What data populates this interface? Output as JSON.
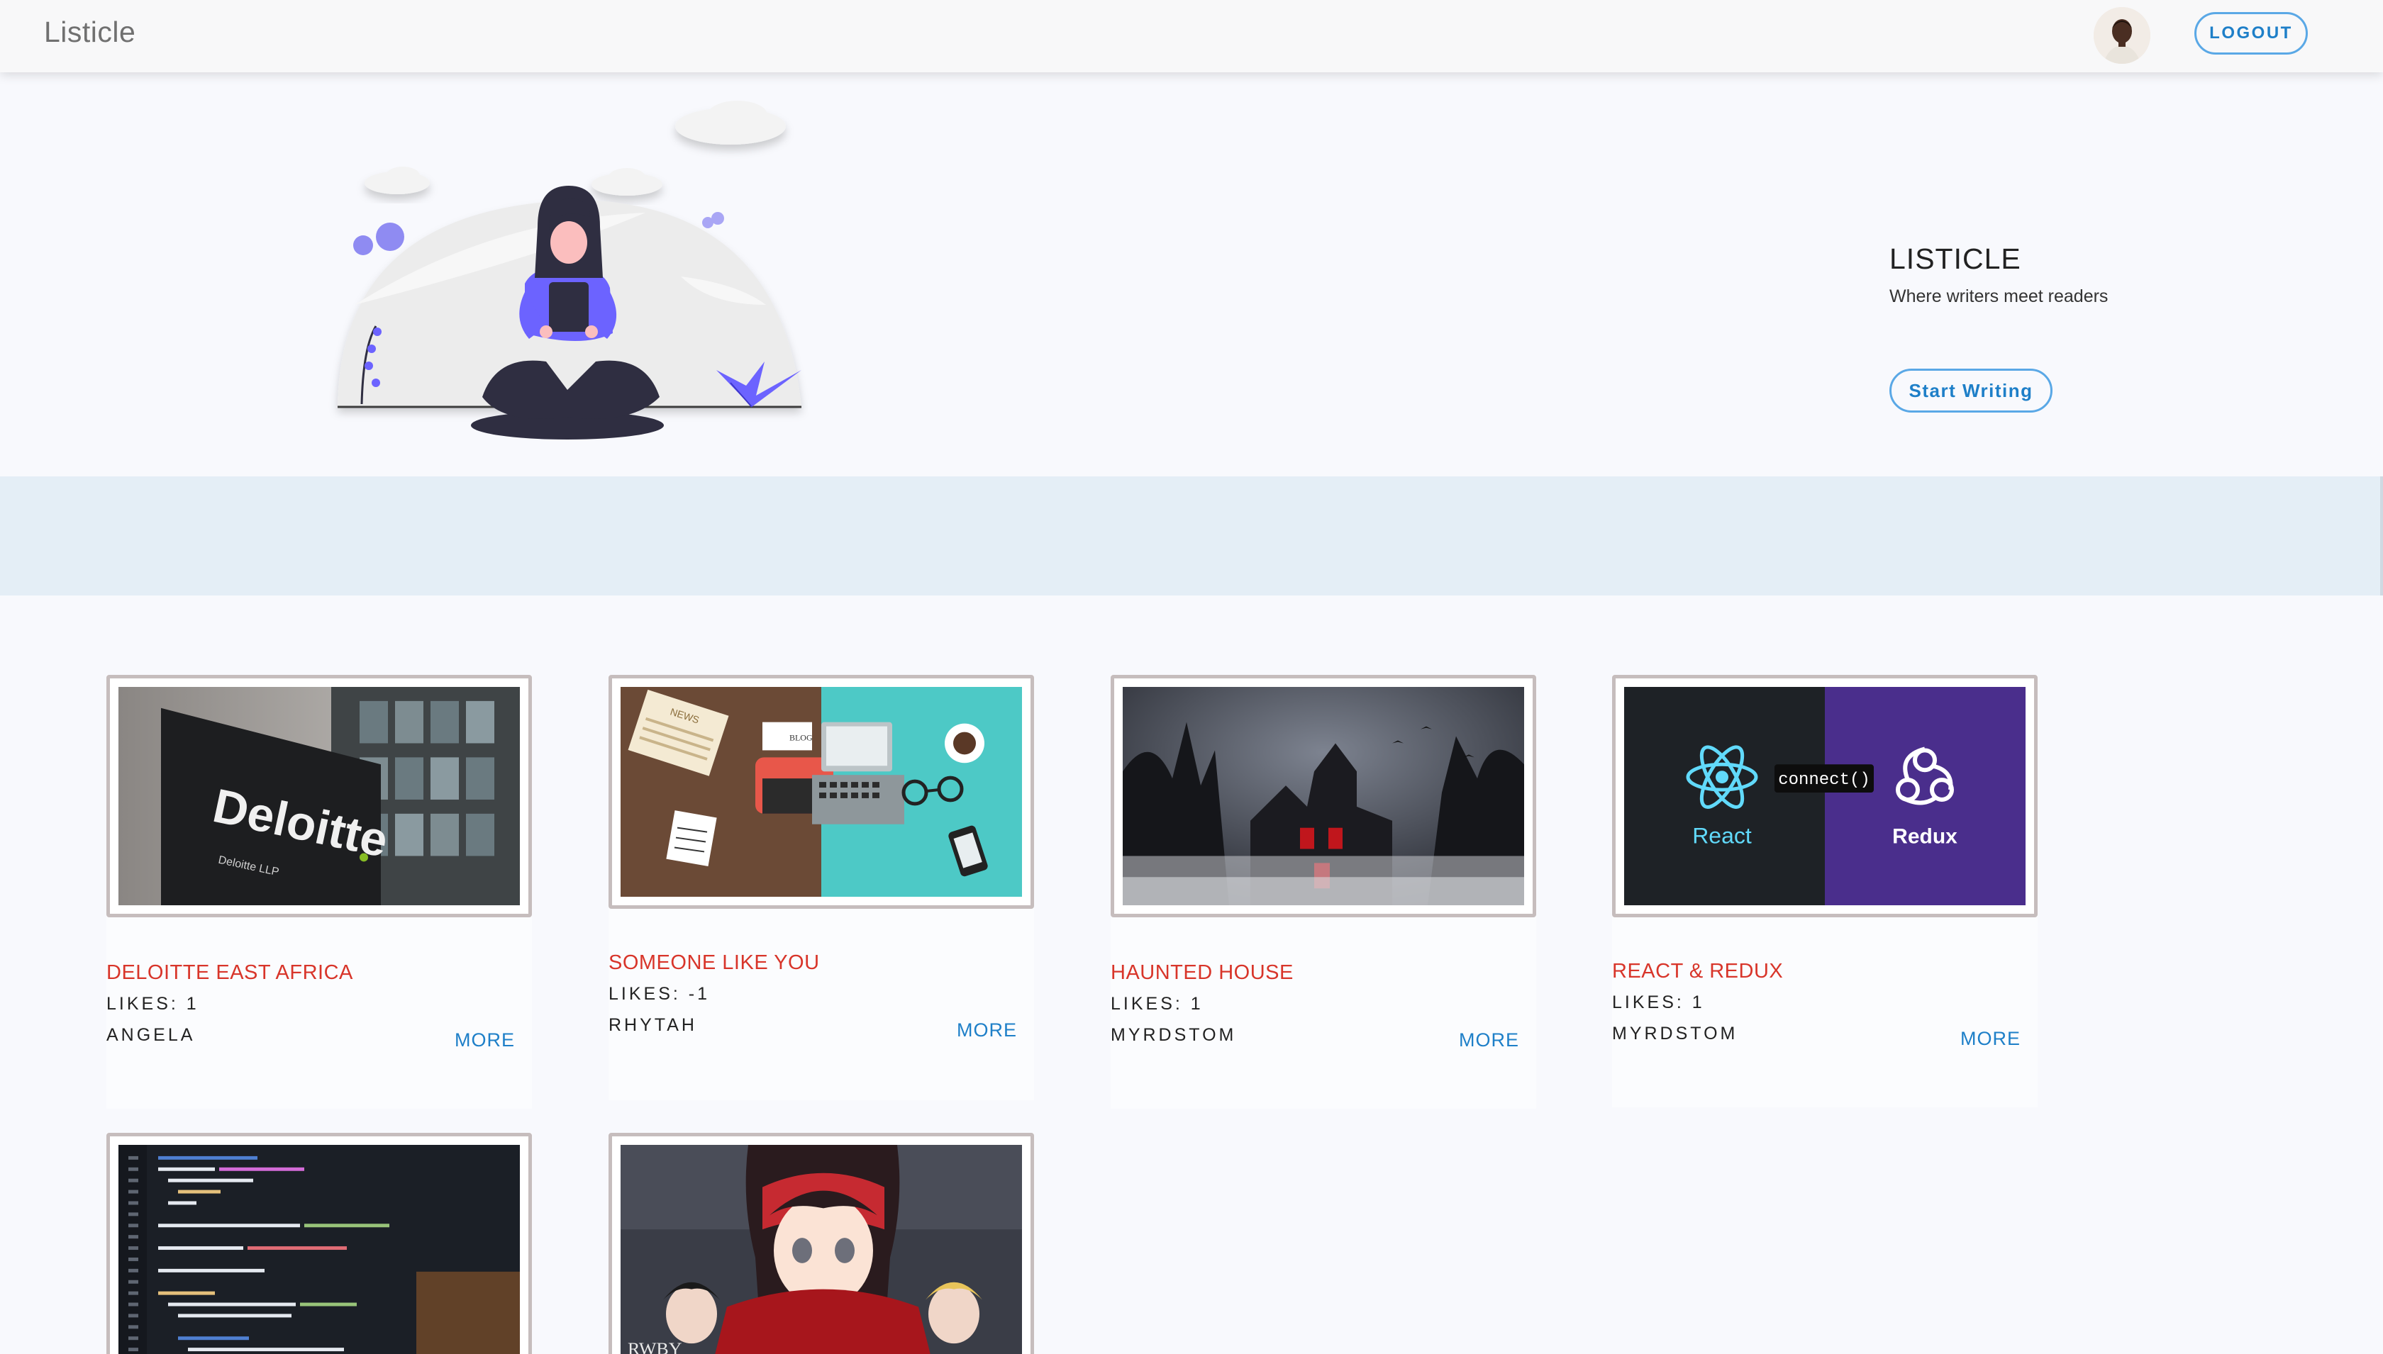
{
  "navbar": {
    "brand": "Listicle",
    "logout_label": "LOGOUT"
  },
  "hero": {
    "title": "LISTICLE",
    "subtitle": "Where writers meet readers",
    "cta_label": "Start Writing"
  },
  "cards": [
    {
      "title": "DELOITTE EAST AFRICA",
      "likes": "LIKES: 1",
      "author": "ANGELA",
      "more": "MORE",
      "image_text": "Deloitte",
      "image_small": "Deloitte LLP"
    },
    {
      "title": "SOMEONE LIKE YOU",
      "likes": "LIKES: -1",
      "author": "RHYTAH",
      "more": "MORE",
      "image_text_news": "NEWS",
      "image_text_blog": "BLOG"
    },
    {
      "title": "HAUNTED HOUSE",
      "likes": "LIKES: 1",
      "author": "MYRDSTOM",
      "more": "MORE"
    },
    {
      "title": "REACT & REDUX",
      "likes": "LIKES: 1",
      "author": "MYRDSTOM",
      "more": "MORE",
      "image_react": "React",
      "image_redux": "Redux",
      "image_connect": "connect()"
    },
    {
      "image_text": "RWBY"
    },
    {}
  ],
  "colors": {
    "accent": "#1e7fc8",
    "title_red": "#d8352a",
    "band": "#e4eef6",
    "illustration_purple": "#6c63ff"
  }
}
